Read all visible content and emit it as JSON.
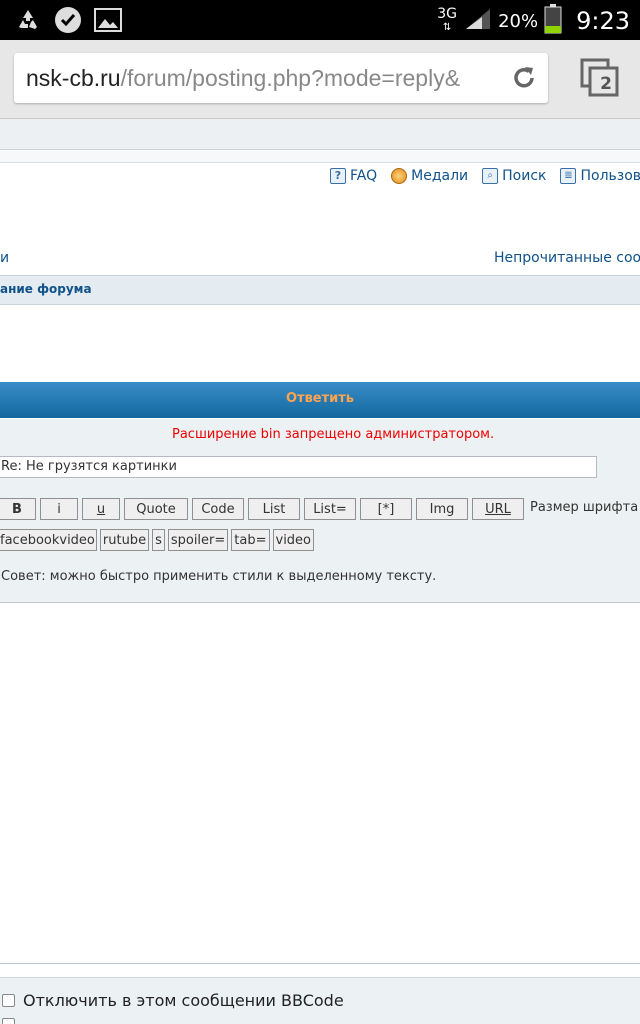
{
  "status": {
    "network": "3G",
    "battery_pct": "20%",
    "time": "9:23"
  },
  "browser": {
    "url_host": "nsk-cb.ru",
    "url_path": "/forum/posting.php?mode=reply&",
    "tab_count": "2"
  },
  "nav": {
    "faq": "FAQ",
    "medals": "Медали",
    "search": "Поиск",
    "users": "Пользова",
    "left_fragment": "и",
    "unread": "Непрочитанные сооб",
    "forum_index": "ание форума"
  },
  "reply": {
    "header": "Ответить",
    "error": "Расширение bin запрещено администратором.",
    "subject_value": "Re: Не грузятся картинки",
    "font_size_label": "Размер шрифта",
    "hint": "Совет: можно быстро применить стили к выделенному тексту."
  },
  "bbcode_row1": [
    "B",
    "i",
    "u",
    "Quote",
    "Code",
    "List",
    "List=",
    "[*]",
    "Img",
    "URL"
  ],
  "bbcode_row2": [
    "facebookvideo",
    "rutube",
    "s",
    "spoiler=",
    "tab=",
    "video"
  ],
  "options": {
    "disable_bbcode": "Отключить в этом сообщении BBCode",
    "second_option": ""
  },
  "colors": {
    "link": "#105289",
    "reply_header_text": "#ffa34f",
    "error": "#ee0000"
  }
}
